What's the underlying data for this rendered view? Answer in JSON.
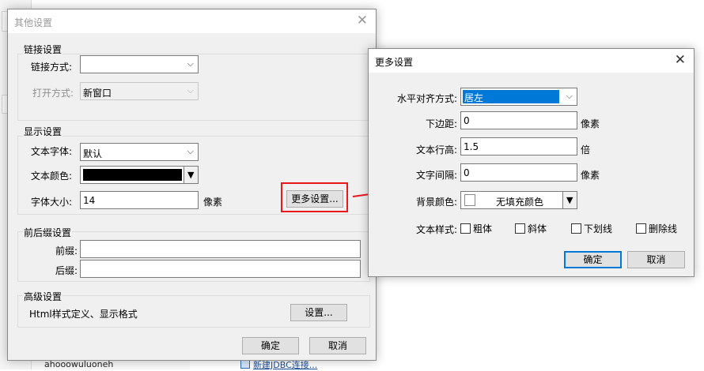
{
  "background": {
    "tree_item_text": "ahooowuluoneh",
    "link_text": "新建JDBC连接..."
  },
  "dialog_other": {
    "title": "其他设置",
    "link": {
      "group_label": "链接设置",
      "mode_label": "链接方式:",
      "mode_value": "",
      "open_label": "打开方式:",
      "open_value": "新窗口"
    },
    "display": {
      "group_label": "显示设置",
      "font_label": "文本字体:",
      "font_value": "默认",
      "color_label": "文本颜色:",
      "color_value": "#000000",
      "size_label": "字体大小:",
      "size_value": "14",
      "size_unit": "像素",
      "more_button": "更多设置..."
    },
    "affix": {
      "group_label": "前后缀设置",
      "prefix_label": "前缀:",
      "prefix_value": "",
      "suffix_label": "后缀:",
      "suffix_value": ""
    },
    "advanced": {
      "group_label": "高级设置",
      "desc": "Html样式定义、显示格式",
      "settings_button": "设置..."
    },
    "ok_button": "确定",
    "cancel_button": "取消"
  },
  "dialog_more": {
    "title": "更多设置",
    "align_label": "水平对齐方式:",
    "align_value": "居左",
    "bottom_margin_label": "下边距:",
    "bottom_margin_value": "0",
    "bottom_margin_unit": "像素",
    "line_height_label": "文本行高:",
    "line_height_value": "1.5",
    "line_height_unit": "倍",
    "letter_spacing_label": "文字间隔:",
    "letter_spacing_value": "0",
    "letter_spacing_unit": "像素",
    "bg_color_label": "背景颜色:",
    "bg_color_value": "无填充颜色",
    "style_label": "文本样式:",
    "styles": [
      "粗体",
      "斜体",
      "下划线",
      "删除线"
    ],
    "ok_button": "确定",
    "cancel_button": "取消"
  },
  "colors": {
    "highlight": "#e8181d",
    "selection": "#0078d7",
    "arrow": "#e8181d"
  }
}
